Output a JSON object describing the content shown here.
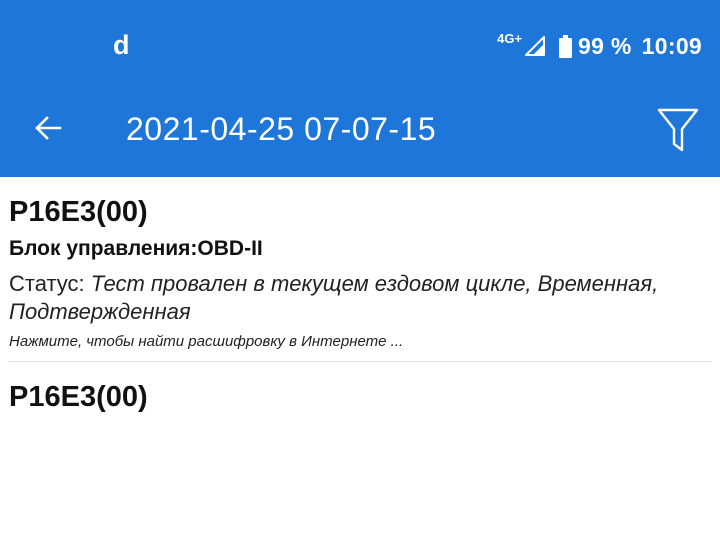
{
  "status_bar": {
    "app_icon": "d",
    "network_type": "4G+",
    "battery_percent": "99 %",
    "time": "10:09"
  },
  "toolbar": {
    "title": "2021-04-25 07-07-15",
    "back_icon": "arrow-left-icon",
    "filter_icon": "filter-icon"
  },
  "items": [
    {
      "code": "P16E3(00)",
      "module": "Блок управления:OBD-II",
      "status_label": "Статус: ",
      "status_value": "Тест провален в текущем ездовом цикле, Временная, Подтвержденная",
      "hint": "Нажмите, чтобы найти расшифровку в Интернете ..."
    },
    {
      "code": "P16E3(00)"
    }
  ],
  "colors": {
    "accent": "#1d76d8",
    "text": "#111111",
    "divider": "#dddddd"
  }
}
